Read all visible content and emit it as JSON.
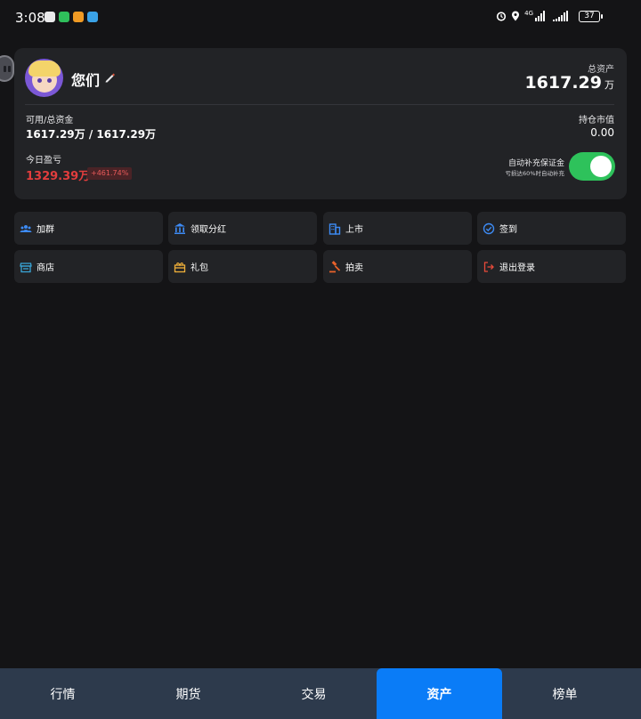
{
  "status_bar": {
    "time": "3:08",
    "network": "4G",
    "battery": "37",
    "notification_icons": [
      "grid-app-icon",
      "wechat-icon",
      "orange-app-icon",
      "blue-app-icon"
    ]
  },
  "account": {
    "username": "您们",
    "total_assets_label": "总资产",
    "total_assets_value": "1617.29",
    "total_assets_unit": "万",
    "available_label": "可用/总资金",
    "available_value": "1617.29万 / 1617.29万",
    "holdings_label": "持仓市值",
    "holdings_value": "0.00",
    "today_pnl_label": "今日盈亏",
    "today_pnl_value": "1329.39万",
    "today_pnl_percent": "+461.74%",
    "auto_margin_label": "自动补充保证金",
    "auto_margin_sub": "亏损达60%时自动补充",
    "auto_margin_enabled": true
  },
  "actions": [
    {
      "label": "加群",
      "icon": "group-icon",
      "color": "#3d8bf5"
    },
    {
      "label": "领取分红",
      "icon": "bank-icon",
      "color": "#3d8bf5"
    },
    {
      "label": "上市",
      "icon": "building-icon",
      "color": "#3d8bf5"
    },
    {
      "label": "签到",
      "icon": "checkin-icon",
      "color": "#3d8bf5"
    },
    {
      "label": "商店",
      "icon": "store-icon",
      "color": "#3aa6d8"
    },
    {
      "label": "礼包",
      "icon": "gift-icon",
      "color": "#f0b03a"
    },
    {
      "label": "拍卖",
      "icon": "gavel-icon",
      "color": "#e8622a"
    },
    {
      "label": "退出登录",
      "icon": "logout-icon",
      "color": "#e84a3a"
    }
  ],
  "tabs": [
    {
      "label": "行情",
      "active": false
    },
    {
      "label": "期货",
      "active": false
    },
    {
      "label": "交易",
      "active": false
    },
    {
      "label": "资产",
      "active": true
    },
    {
      "label": "榜单",
      "active": false
    }
  ],
  "colors": {
    "background": "#141416",
    "card": "#222326",
    "accent": "#0a7cf7",
    "loss_red": "#e23d3d",
    "toggle_green": "#2ec25b",
    "tabbar": "#2d3a4c"
  }
}
